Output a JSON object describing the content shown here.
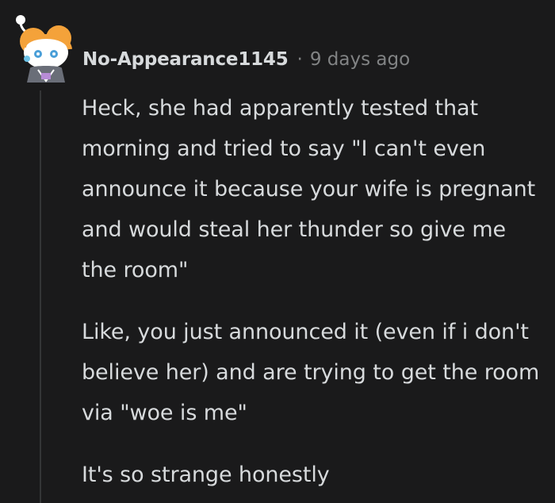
{
  "comment": {
    "author": "No-Appearance1145",
    "separator": "·",
    "timestamp": "9 days ago",
    "avatar": "snoo-avatar-icon",
    "paragraphs": [
      "Heck, she had apparently tested that morning and tried to say \"I can't even announce it because your wife is pregnant and would steal her thunder so give me the room\"",
      "Like, you just announced it (even if i don't believe her) and are trying to get the room via \"woe is me\"",
      "It's so strange honestly"
    ]
  },
  "colors": {
    "background": "#1a1a1b",
    "text": "#d7dadc",
    "meta": "#818384",
    "thread_line": "#343536"
  }
}
